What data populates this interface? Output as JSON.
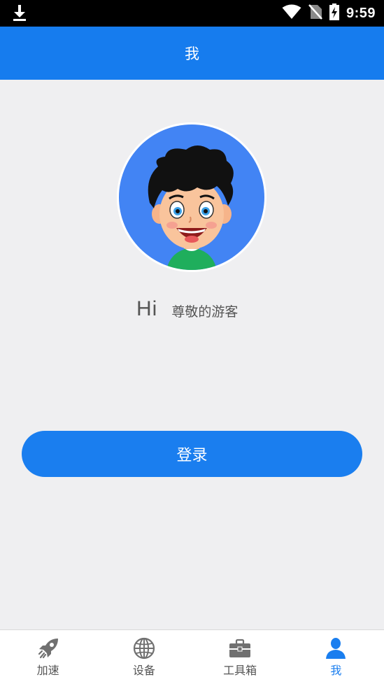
{
  "status_bar": {
    "time": "9:59",
    "icons": [
      "download-icon",
      "wifi-icon",
      "no-sim-icon",
      "battery-charging-icon"
    ]
  },
  "header": {
    "title": "我"
  },
  "profile": {
    "hi": "Hi",
    "name": "尊敬的游客"
  },
  "login": {
    "label": "登录"
  },
  "tabs": [
    {
      "label": "加速",
      "icon": "rocket-icon",
      "active": false
    },
    {
      "label": "设备",
      "icon": "globe-icon",
      "active": false
    },
    {
      "label": "工具箱",
      "icon": "toolbox-icon",
      "active": false
    },
    {
      "label": "我",
      "icon": "user-icon",
      "active": true
    }
  ],
  "colors": {
    "accent": "#167cee",
    "avatar_bg": "#4284f4",
    "background": "#efeff1",
    "tab_inactive": "#555555",
    "tab_active": "#1a7eef"
  }
}
